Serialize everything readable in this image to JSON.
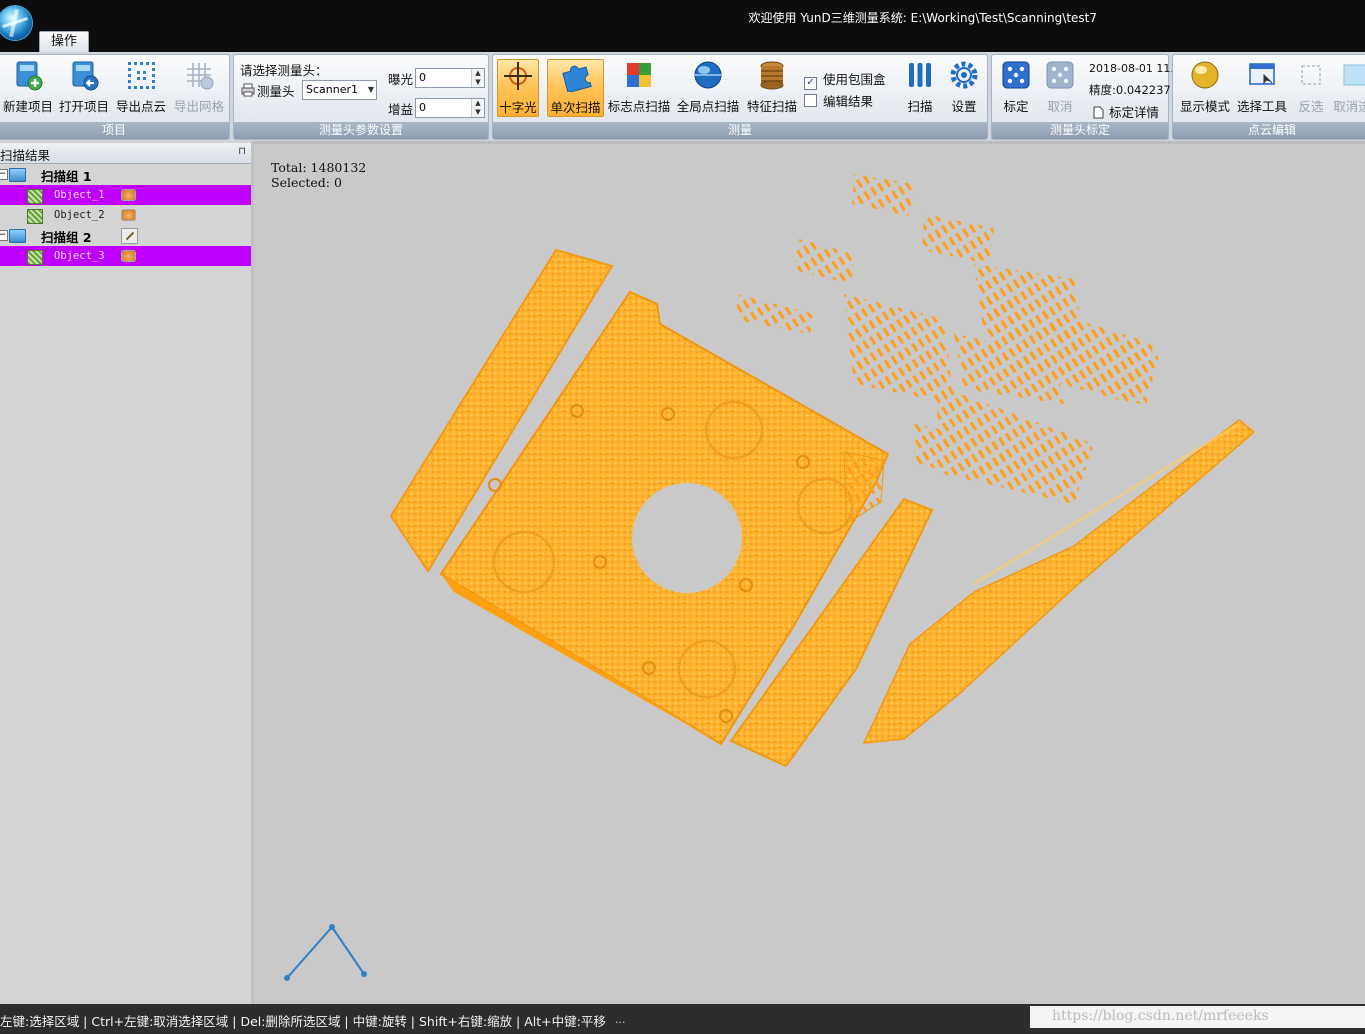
{
  "window": {
    "title": "欢迎使用 YunD三维测量系统: E:\\Working\\Test\\Scanning\\test7",
    "tab_label": "操作"
  },
  "ribbon": {
    "project": {
      "caption": "项目",
      "new_project": "新建项目",
      "open_project": "打开项目",
      "export_pointcloud": "导出点云",
      "export_mesh": "导出网格"
    },
    "head_params": {
      "caption": "测量头参数设置",
      "select_head_label": "请选择测量头：",
      "head_label": "测量头",
      "head_value": "Scanner1",
      "exposure_label": "曝光",
      "exposure_value": "0",
      "gain_label": "增益",
      "gain_value": "0"
    },
    "measure": {
      "caption": "测量",
      "crosshair": "十字光",
      "single_scan": "单次扫描",
      "marker_scan": "标志点扫描",
      "global_scan": "全局点扫描",
      "feature_scan": "特征扫描",
      "use_bbox": "使用包围盒",
      "use_bbox_checked": true,
      "edit_result": "编辑结果",
      "edit_result_checked": false,
      "scan": "扫描",
      "settings": "设置"
    },
    "calibration": {
      "caption": "测量头标定",
      "calibrate": "标定",
      "cancel": "取消",
      "date": "2018-08-01 11.",
      "precision": "精度:0.042237",
      "details": "标定详情"
    },
    "pointcloud_edit": {
      "caption": "点云编辑",
      "display_mode": "显示模式",
      "select_tool": "选择工具",
      "invert": "反选",
      "cancel_select": "取消选"
    }
  },
  "left_panel": {
    "title": "扫描结果",
    "groups": [
      {
        "label": "扫描组  1",
        "objects": [
          {
            "name": "Object_1",
            "selected": true
          },
          {
            "name": "Object_2",
            "selected": false
          }
        ]
      },
      {
        "label": "扫描组  2",
        "objects": [
          {
            "name": "Object_3",
            "selected": true
          }
        ]
      }
    ]
  },
  "viewport": {
    "total": "Total: 1480132",
    "selected": "Selected: 0",
    "point_color": "#ffa21f",
    "background": "#c9c9c9"
  },
  "statusbar": {
    "hint": "左键:选择区域 | Ctrl+左键:取消选择区域 | Del:删除所选区域 | 中键:旋转 | Shift+右键:缩放 | Alt+中键:平移",
    "ellipsis": "...",
    "watermark": "https://blog.csdn.net/mrfeeeks"
  },
  "colors": {
    "selection": "#c000ff",
    "active_button": "#ffc45c",
    "axis": "#2f7fc4"
  }
}
